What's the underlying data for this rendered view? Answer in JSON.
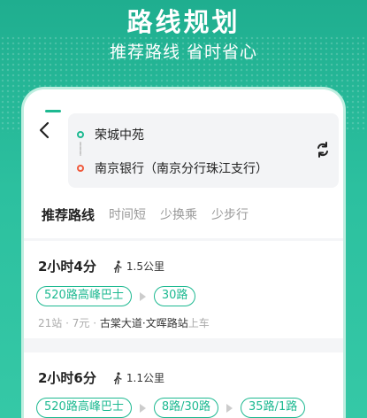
{
  "hero": {
    "title": "路线规划",
    "subtitle": "推荐路线 省时省心"
  },
  "route": {
    "from": "荣城中苑",
    "to": "南京银行（南京分行珠江支行）"
  },
  "tabs": [
    {
      "label": "推荐路线",
      "active": true
    },
    {
      "label": "时间短",
      "active": false
    },
    {
      "label": "少换乘",
      "active": false
    },
    {
      "label": "少步行",
      "active": false
    }
  ],
  "results": [
    {
      "duration": "2小时4分",
      "walk": "1.5公里",
      "lines": [
        "520路高峰巴士",
        "30路"
      ],
      "stops": "21站",
      "sep1": "·",
      "price": "7元",
      "sep2": "·",
      "board_stop": "古棠大道·文晖路站",
      "board_suffix": "上车"
    },
    {
      "duration": "2小时6分",
      "walk": "1.1公里",
      "lines": [
        "520路高峰巴士",
        "8路/30路",
        "35路/1路"
      ]
    }
  ],
  "colors": {
    "accent": "#1db991",
    "destination": "#f05a3c",
    "background": "#2bb79a"
  }
}
